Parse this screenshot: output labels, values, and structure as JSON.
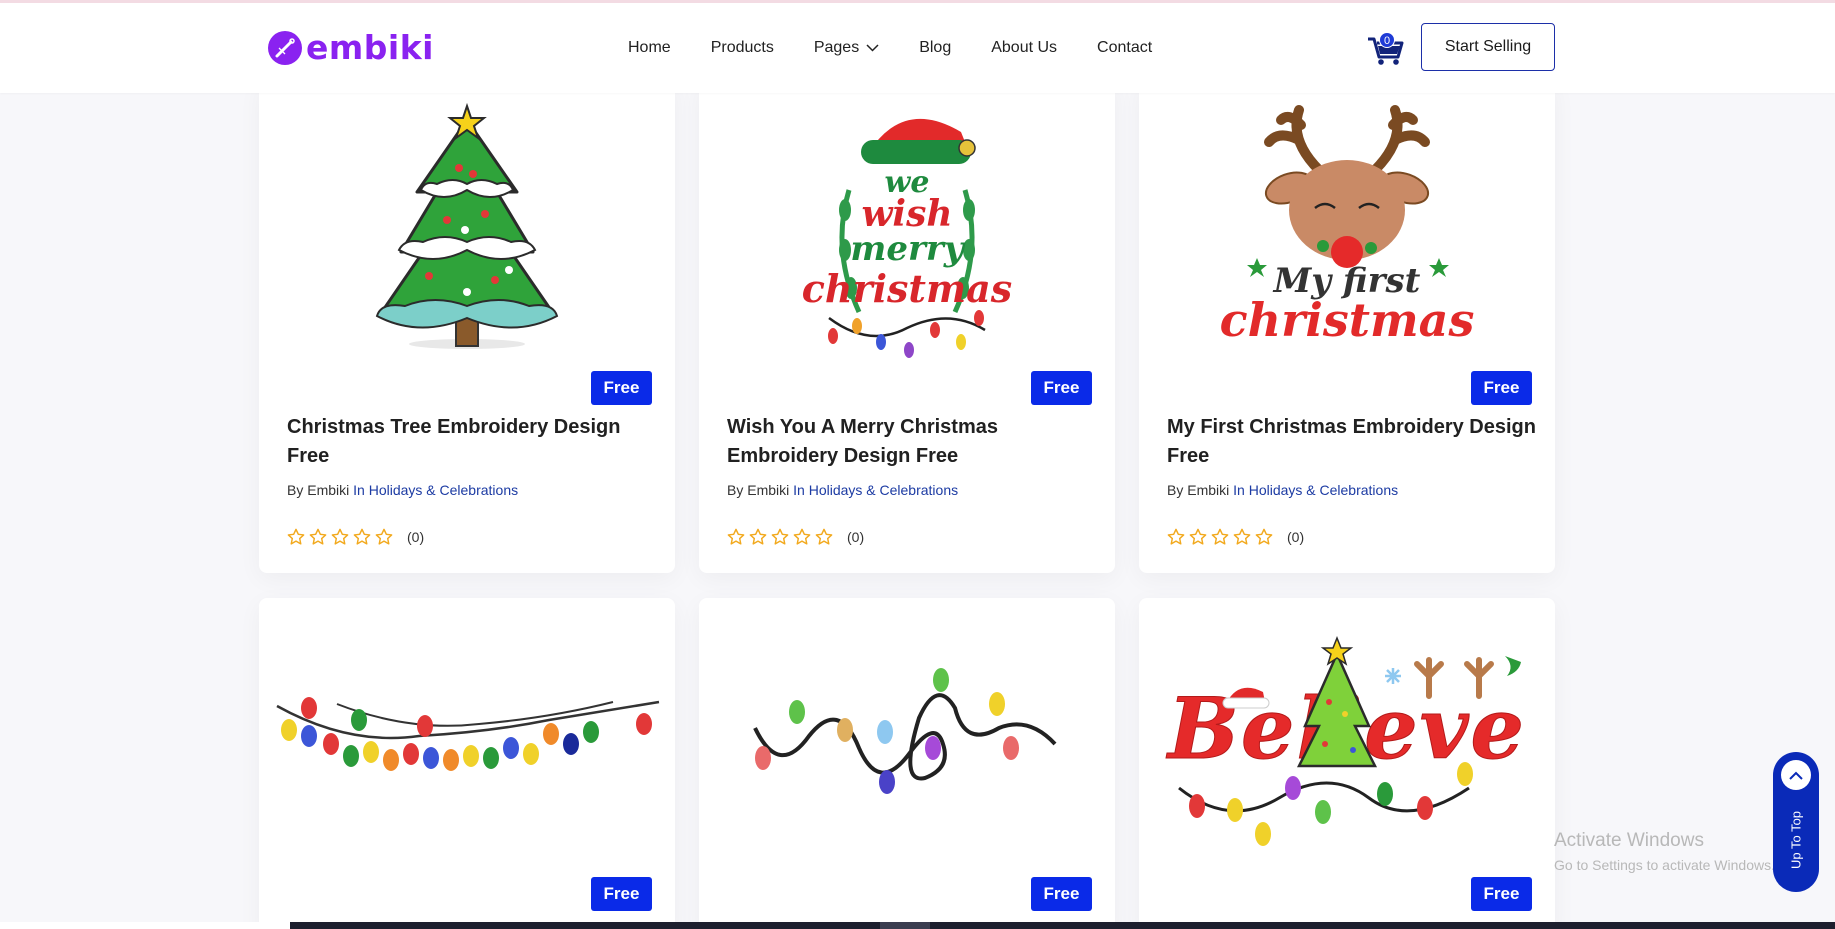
{
  "header": {
    "logo": "embiki",
    "nav": [
      {
        "label": "Home"
      },
      {
        "label": "Products"
      },
      {
        "label": "Pages"
      },
      {
        "label": "Blog"
      },
      {
        "label": "About Us"
      },
      {
        "label": "Contact"
      }
    ],
    "cart_count": "0",
    "cta": "Start Selling"
  },
  "products": [
    {
      "title": "Christmas Tree Embroidery Design Free",
      "badge": "Free",
      "by": "By",
      "author": "Embiki",
      "category": "In Holidays & Celebrations",
      "rating": 0,
      "reviews": "(0)"
    },
    {
      "title": "Wish You A Merry Christmas Embroidery Design Free",
      "badge": "Free",
      "by": "By",
      "author": "Embiki",
      "category": "In Holidays & Celebrations",
      "rating": 0,
      "reviews": "(0)"
    },
    {
      "title": "My First Christmas Embroidery Design Free",
      "badge": "Free",
      "by": "By",
      "author": "Embiki",
      "category": "In Holidays & Celebrations",
      "rating": 0,
      "reviews": "(0)"
    },
    {
      "badge": "Free"
    },
    {
      "badge": "Free"
    },
    {
      "badge": "Free"
    }
  ],
  "image_text": {
    "we": "we",
    "wish": "wish",
    "merry": "merry",
    "christmas": "christmas",
    "my_first": "My first",
    "believe": "Believe"
  },
  "overlay": {
    "activate_title": "Activate Windows",
    "activate_sub": "Go to Settings to activate Windows.",
    "up_to_top": "Up To Top"
  },
  "colors": {
    "brand": "#8a22f0",
    "accent": "#0a2ae8",
    "link": "#1c3ba3",
    "star": "#f2a91d"
  }
}
